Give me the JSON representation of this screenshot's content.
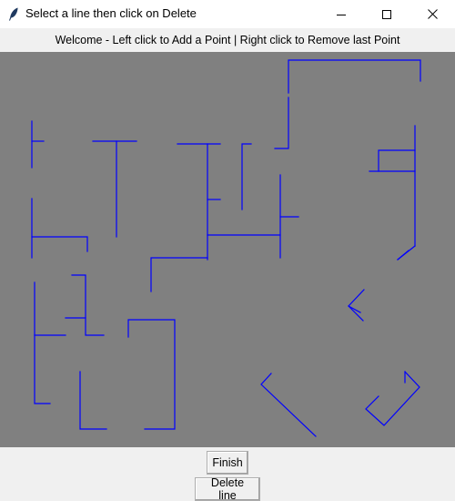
{
  "window": {
    "title": "Select a line then click on Delete",
    "icon": "feather-icon",
    "controls": [
      "minimize-icon",
      "maximize-icon",
      "close-icon"
    ]
  },
  "status": {
    "text": "Welcome - Left click to Add a Point | Right click to Remove last Point"
  },
  "canvas": {
    "background": "#808080",
    "line_color": "#0000ff"
  },
  "buttons": {
    "finish_label": "Finish",
    "delete_label": "Delete line"
  }
}
